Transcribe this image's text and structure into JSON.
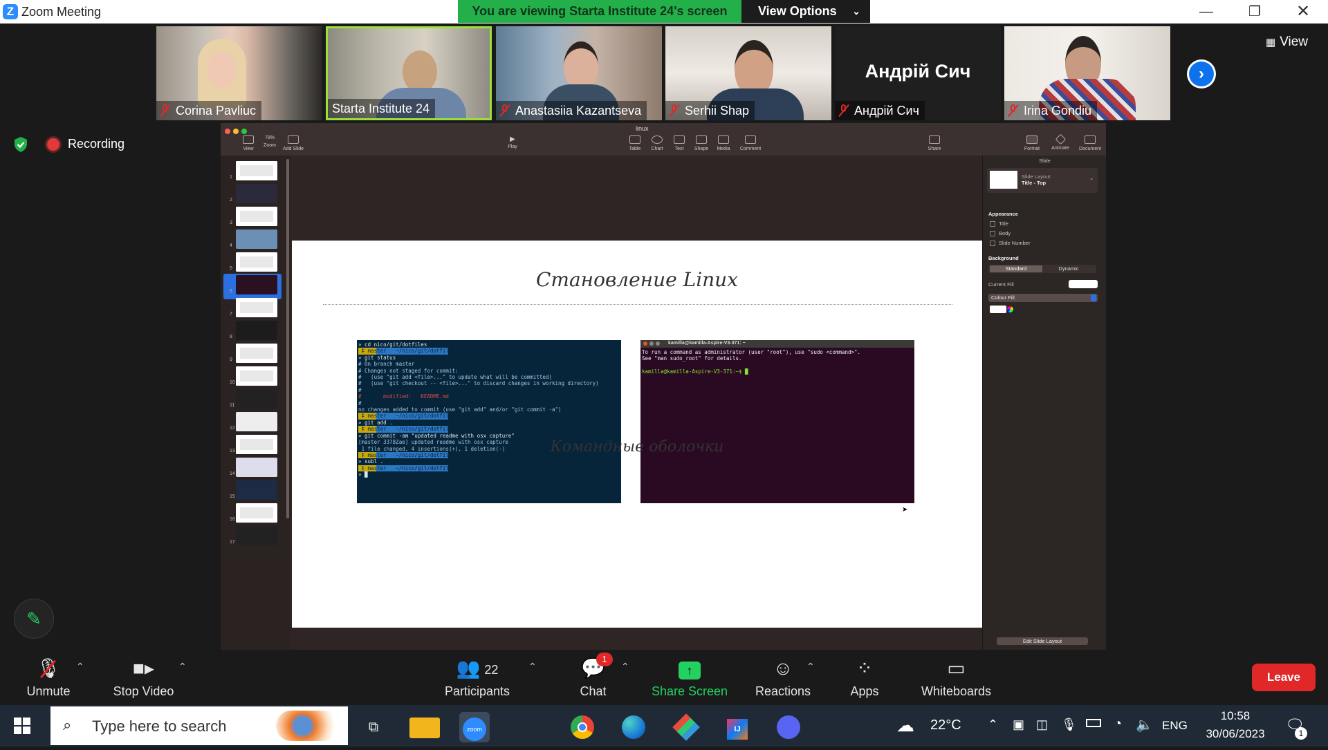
{
  "window": {
    "title": "Zoom Meeting",
    "banner": "You are viewing Starta Institute 24's screen",
    "view_options": "View Options",
    "view_label": "View"
  },
  "participants_strip": [
    {
      "name": "Corina Pavliuc",
      "muted": true
    },
    {
      "name": "Starta Institute 24",
      "muted": false,
      "active": true
    },
    {
      "name": "Anastasiia Kazantseva",
      "muted": true
    },
    {
      "name": "Serhii Shap",
      "muted": true
    },
    {
      "name": "Андрій Сич",
      "muted": true,
      "video": false
    },
    {
      "name": "Irina Gondiu",
      "muted": true
    }
  ],
  "recording": {
    "label": "Recording"
  },
  "keynote": {
    "doc_title": "linux",
    "toolbar": {
      "view": "View",
      "zoom": "Zoom",
      "zoom_value": "78%",
      "add_slide": "Add Slide",
      "play": "Play",
      "table": "Table",
      "chart": "Chart",
      "text": "Text",
      "shape": "Shape",
      "media": "Media",
      "comment": "Comment",
      "share": "Share",
      "format": "Format",
      "animate": "Animate",
      "document": "Document"
    },
    "slide_numbers": [
      "1",
      "2",
      "3",
      "4",
      "5",
      "6",
      "7",
      "8",
      "9",
      "10",
      "11",
      "12",
      "13",
      "14",
      "15",
      "16",
      "17"
    ],
    "current_slide": 6,
    "slide": {
      "title": "Становление Linux",
      "subtitle": "Командные оболочки",
      "term1_lines": [
        "» cd nico/git/dotfiles",
        " ‡ master   ~/nico/git/dotfiles ",
        "» git status",
        "# On branch master",
        "# Changes not staged for commit:",
        "#   (use \"git add <file>...\" to update what will be committed)",
        "#   (use \"git checkout -- <file>...\" to discard changes in working directory)",
        "#",
        "#       modified:   README.md",
        "#",
        "no changes added to commit (use \"git add\" and/or \"git commit -a\")",
        " ‡ master   ~/nico/git/dotfiles ",
        "» git add .",
        " ‡ master   ~/nico/git/dotfiles ",
        "» git commit -am \"updated readme with osx capture\"",
        "[master 3378Zae] updated readme with osx capture",
        " 1 file changed, 4 insertions(+), 1 deletion(-)",
        " ‡ master   ~/nico/git/dotfiles ",
        "» subl .",
        " ‡ master   ~/nico/git/dotfiles ",
        "» █"
      ],
      "term2_title": "kamilla@kamilla-Aspire-V3-371: ~",
      "term2_lines": [
        "To run a command as administrator (user \"root\"), use \"sudo <command>\".",
        "See \"man sudo_root\" for details.",
        "",
        "kamilla@kamilla-Aspire-V3-371:~$ █"
      ]
    },
    "inspector": {
      "header": "Slide",
      "layout_label": "Slide Layout",
      "layout_value": "Title - Top",
      "appearance": "Appearance",
      "checks": [
        "Title",
        "Body",
        "Slide Number"
      ],
      "background": "Background",
      "seg_standard": "Standard",
      "seg_dynamic": "Dynamic",
      "current_fill": "Current Fill",
      "fill_type": "Colour Fill",
      "edit_layout": "Edit Slide Layout"
    }
  },
  "controls": {
    "unmute": "Unmute",
    "stop_video": "Stop Video",
    "participants": "Participants",
    "participants_count": "22",
    "chat": "Chat",
    "chat_badge": "1",
    "share_screen": "Share Screen",
    "reactions": "Reactions",
    "apps": "Apps",
    "whiteboards": "Whiteboards",
    "leave": "Leave"
  },
  "taskbar": {
    "search_placeholder": "Type here to search",
    "temperature": "22°C",
    "language": "ENG",
    "time": "10:58",
    "date": "30/06/2023",
    "notifications": "1"
  },
  "colors": {
    "zoom_blue": "#2D8CFF",
    "banner_green": "#23b04b",
    "leave_red": "#e02828",
    "share_green": "#23d160"
  }
}
